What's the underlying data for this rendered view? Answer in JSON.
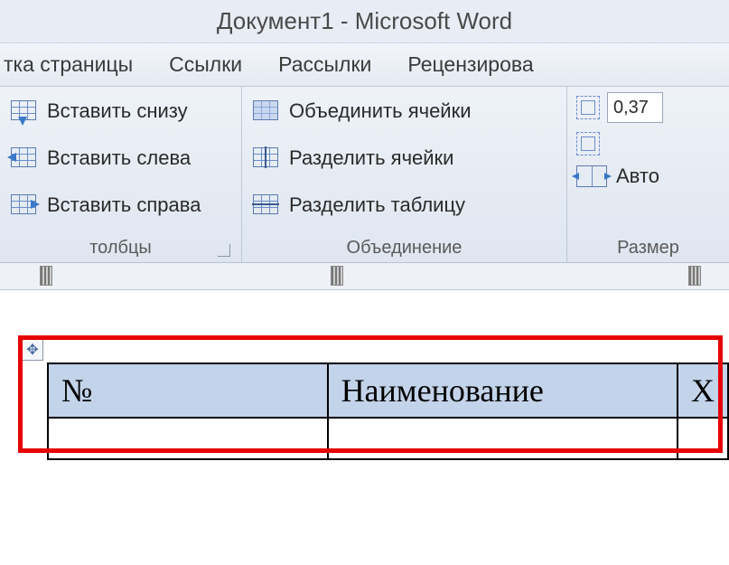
{
  "title": "Документ1 - Microsoft Word",
  "tabs": [
    "тка страницы",
    "Ссылки",
    "Рассылки",
    "Рецензирова"
  ],
  "ribbon": {
    "rows_cols": {
      "insert_below": "Вставить снизу",
      "insert_left": "Вставить слева",
      "insert_right": "Вставить справа",
      "group_label": "толбцы"
    },
    "merge": {
      "merge_cells": "Объединить ячейки",
      "split_cells": "Разделить ячейки",
      "split_table": "Разделить таблицу",
      "group_label": "Объединение"
    },
    "size": {
      "height_value": "0,37",
      "autofit": "Авто",
      "group_label": "Размер"
    }
  },
  "table": {
    "header": [
      "№",
      "Наименование",
      "Х"
    ],
    "body": [
      "",
      "",
      ""
    ]
  }
}
